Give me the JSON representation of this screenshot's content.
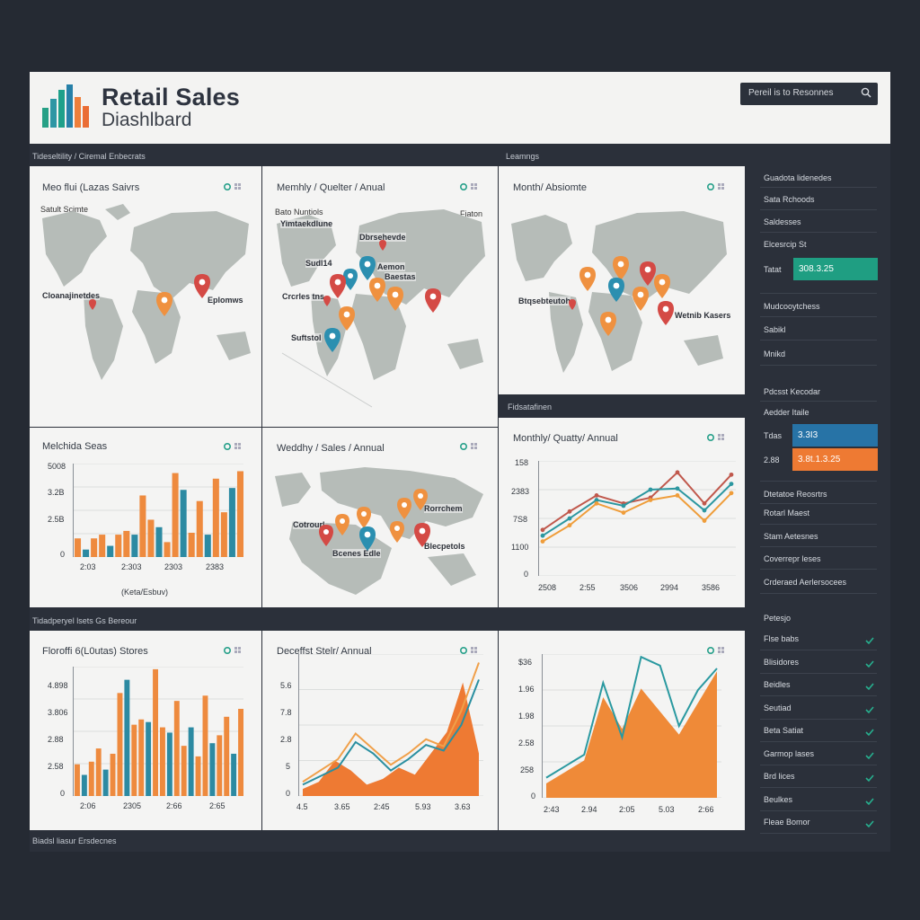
{
  "header": {
    "title_line1": "Retail Sales",
    "title_line2": "Diashlbard",
    "search_placeholder": "Pereil is to Resonnes"
  },
  "sections": {
    "top_left": "Tideseltility / Ciremal Enbecrats",
    "top_right": "Leamngs",
    "middle": "Fidsatafinen",
    "bottom": "Tidadperyel lsets Gs Bereour",
    "footer": "Biadsl liasur Ersdecnes"
  },
  "panels": {
    "map1": {
      "title": "Meo flui (Lazas Saivrs",
      "sub": "Satult Scimte",
      "labels": [
        "Cloanajinetdes",
        "Eplomws"
      ]
    },
    "map2": {
      "title": "Memhly / Quelter / Anual",
      "sub": "Bato Nuntiols",
      "corner": "Fiaton",
      "labels": [
        "Dbrsehevde",
        "Yimtaekdlune",
        "Sudl14",
        "Aemon",
        "Baestas",
        "Crcrles tns",
        "Suftstol"
      ]
    },
    "map3": {
      "title": "Month/ Absiomte",
      "labels": [
        "Btqsebteutoh",
        "Wetnib Kasers"
      ]
    },
    "bar1": {
      "title": "Melchida Seas",
      "yticks": [
        "5008",
        "3.2B",
        "2.5B",
        "0"
      ],
      "xticks": [
        "2:03",
        "2:303",
        "2303",
        "2383"
      ],
      "xlabel": "(Keta/Esbuv)"
    },
    "map4": {
      "title": "Weddhy / Sales / Annual",
      "labels": [
        "Cotrourl",
        "Rorrchem",
        "Bcenes Edle",
        "Blecpetols"
      ]
    },
    "line1": {
      "title": "Monthly/ Quatty/ Annual",
      "yticks": [
        "158",
        "2383",
        "7S8",
        "1100",
        "0"
      ],
      "xticks": [
        "2508",
        "2:55",
        "3506",
        "2994",
        "3586"
      ]
    },
    "bar2": {
      "title": "Floroffi 6(L0utas) Stores",
      "yticks": [
        "4.898",
        "3.806",
        "2.88",
        "2.58",
        "0"
      ],
      "xticks": [
        "2:06",
        "2305",
        "2:66",
        "2:65"
      ]
    },
    "area1": {
      "title": "Deceffst Stelr/ Annual",
      "yticks": [
        "5.6",
        "7.8",
        "2.8",
        "5",
        "0"
      ],
      "xticks": [
        "4.5",
        "3.65",
        "2:45",
        "5.93",
        "3.63"
      ]
    },
    "area2": {
      "yticks": [
        "$36",
        "1.96",
        "1.98",
        "2.58",
        "258",
        "0"
      ],
      "xticks": [
        "2:43",
        "2.94",
        "2:05",
        "5.03",
        "2:66"
      ]
    }
  },
  "sidebar": {
    "group1": [
      "Guadota lidenedes",
      "Sata Rchoods",
      "Saldesses",
      "Elcesrcip St"
    ],
    "chip1": {
      "label": "Tatat",
      "value": "308.3.25",
      "color": "#1f9e82"
    },
    "group2": [
      "Mudcooytchess",
      "Sabikl",
      "Mnikd"
    ],
    "group3": [
      "Pdcsst Kecodar",
      "Aedder Itaile"
    ],
    "chip2": {
      "label": "Tdas",
      "value": "3.3I3",
      "color": "#2773a6"
    },
    "chip3": {
      "label": "2.88",
      "value": "3.8t.1.3.25",
      "color": "#ee7a33"
    },
    "group4": [
      "Dtetatoe Reosrtrs",
      "Rotarl Maest",
      "Stam Aetesnes",
      "Coverrepr leses",
      "Crderaed Aerlersocees"
    ],
    "checks_title": "Petesjo",
    "checks": [
      "Flse babs",
      "Blisidores",
      "Beidles",
      "Seutiad",
      "Beta Satiat",
      "Garmop lases",
      "Brd lices",
      "Beulkes",
      "Fleae Bomor"
    ]
  },
  "chart_data": [
    {
      "type": "bar",
      "title": "Melchida Seas",
      "xlabel": "(Keta/Esbuv)",
      "ylim": [
        0,
        5008
      ],
      "series": [
        {
          "values": [
            1000,
            400,
            1000,
            1200,
            600,
            1200,
            1400,
            1200,
            3300,
            2000,
            1600,
            800,
            4500,
            3600,
            1300,
            3000,
            1200,
            4200,
            2400,
            3700,
            4600
          ]
        }
      ],
      "series_colors": [
        "#ee8a3e",
        "#2c8aa2"
      ]
    },
    {
      "type": "line",
      "title": "Monthly/ Quatty/ Annual",
      "x": [
        "2508",
        "2:55",
        "3506",
        "2994",
        "3586"
      ],
      "series": [
        {
          "values": [
            40,
            56,
            70,
            63,
            68,
            90,
            63,
            88
          ],
          "color": "#c0584c"
        },
        {
          "values": [
            35,
            50,
            66,
            61,
            75,
            76,
            57,
            80
          ],
          "color": "#2c97a0"
        },
        {
          "values": [
            30,
            44,
            63,
            55,
            66,
            70,
            48,
            72
          ],
          "color": "#ef9d3a"
        }
      ],
      "ylim": [
        0,
        100
      ]
    },
    {
      "type": "bar",
      "title": "Floroffi 6(L0utas) Stores",
      "ylim": [
        0,
        4898
      ],
      "series": [
        {
          "values": [
            1200,
            800,
            1300,
            1800,
            1000,
            1600,
            3900,
            4400,
            2700,
            2900,
            2800,
            4800,
            2600,
            2400,
            3600,
            1900,
            2600,
            1500,
            3800,
            2000,
            2300,
            3000,
            1600,
            3300
          ]
        }
      ],
      "series_colors": [
        "#ee8a3e",
        "#2c8aa2"
      ]
    },
    {
      "type": "area",
      "title": "Deceffst Stelr/ Annual",
      "series": [
        {
          "values": [
            10,
            18,
            26,
            44,
            33,
            22,
            30,
            40,
            35,
            60,
            94
          ],
          "color": "#f0a04a",
          "kind": "line"
        },
        {
          "values": [
            8,
            14,
            20,
            38,
            30,
            18,
            26,
            36,
            32,
            50,
            82
          ],
          "color": "#2a8fa0",
          "kind": "line"
        },
        {
          "values": [
            5,
            10,
            25,
            18,
            8,
            12,
            20,
            15,
            30,
            45,
            80,
            30
          ],
          "color": "#ee7a33",
          "kind": "area"
        }
      ],
      "ylim": [
        0,
        100
      ]
    },
    {
      "type": "area",
      "series": [
        {
          "values": [
            14,
            22,
            30,
            80,
            42,
            98,
            92,
            50,
            75,
            90
          ],
          "color": "#2a99a0",
          "kind": "line"
        },
        {
          "values": [
            10,
            18,
            26,
            70,
            48,
            76,
            60,
            44,
            66,
            88
          ],
          "color": "#ef8a38",
          "kind": "area"
        }
      ],
      "ylim": [
        0,
        100
      ]
    }
  ]
}
